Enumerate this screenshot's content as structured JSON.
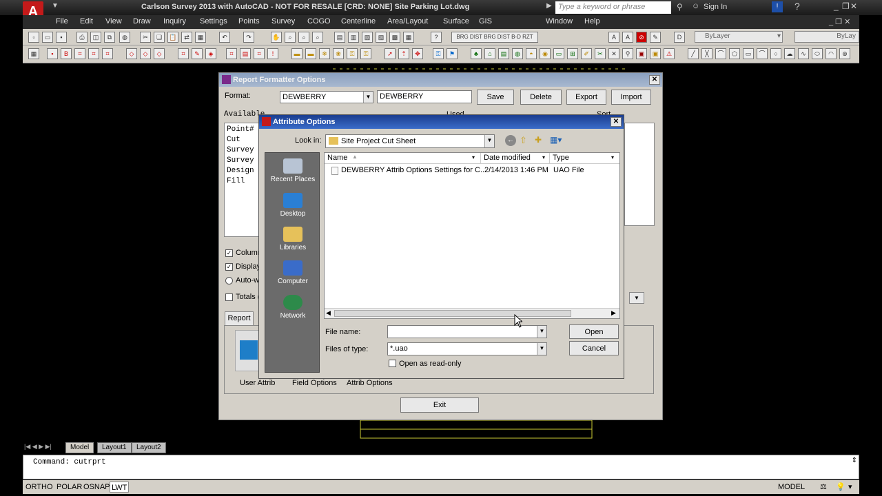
{
  "app": {
    "title": "Carlson Survey 2013 with AutoCAD - NOT FOR RESALE [CRD: NONE]   Site Parking Lot.dwg",
    "search_placeholder": "Type a keyword or phrase",
    "sign_in": "Sign In",
    "logo": "A"
  },
  "menu": [
    "File",
    "Edit",
    "View",
    "Draw",
    "Inquiry",
    "Settings",
    "Points",
    "Survey",
    "COGO",
    "Centerline",
    "Area/Layout",
    "Surface",
    "GIS",
    "Window",
    "Help"
  ],
  "toolbar": {
    "layer_label": "ByLayer",
    "linetype_label": "ByLay"
  },
  "report_dialog": {
    "title": "Report Formatter Options",
    "format_label": "Format:",
    "format_select": "DEWBERRY",
    "format_text": "DEWBERRY",
    "buttons": {
      "save": "Save",
      "delete": "Delete",
      "export": "Export",
      "import": "Import"
    },
    "available_label": "Available",
    "used_label": "Used",
    "sort_label": "Sort",
    "available_items": [
      "Point#",
      "Cut",
      "Survey",
      "Survey",
      "Design",
      "Fill"
    ],
    "checkboxes": [
      {
        "label": "Column",
        "checked": true
      },
      {
        "label": "Display",
        "checked": true
      },
      {
        "label": "Auto-w",
        "checked": false,
        "radio": true
      },
      {
        "label": "Totals (",
        "checked": false
      }
    ],
    "report_tab": "Report",
    "bottom_tabs": [
      "User Attrib",
      "Field Options",
      "Attrib Options"
    ],
    "exit_button": "Exit"
  },
  "attr_dialog": {
    "title": "Attribute Options",
    "look_in_label": "Look in:",
    "look_in_value": "Site Project Cut Sheet",
    "places": [
      "Recent Places",
      "Desktop",
      "Libraries",
      "Computer",
      "Network"
    ],
    "columns": [
      "Name",
      "Date modified",
      "Type"
    ],
    "files": [
      {
        "name": "DEWBERRY Attrib Options Settings for C...",
        "date": "2/14/2013 1:46 PM",
        "type": "UAO File"
      }
    ],
    "file_name_label": "File name:",
    "file_name_value": "",
    "files_of_type_label": "Files of type:",
    "files_of_type_value": "*.uao",
    "read_only_label": "Open as read-only",
    "open_button": "Open",
    "cancel_button": "Cancel"
  },
  "layout_tabs": [
    "Model",
    "Layout1",
    "Layout2"
  ],
  "command_line": "Command: cutrprt",
  "status": {
    "items": [
      "ORTHO",
      "POLAR",
      "OSNAP",
      "LWT"
    ],
    "model": "MODEL"
  }
}
